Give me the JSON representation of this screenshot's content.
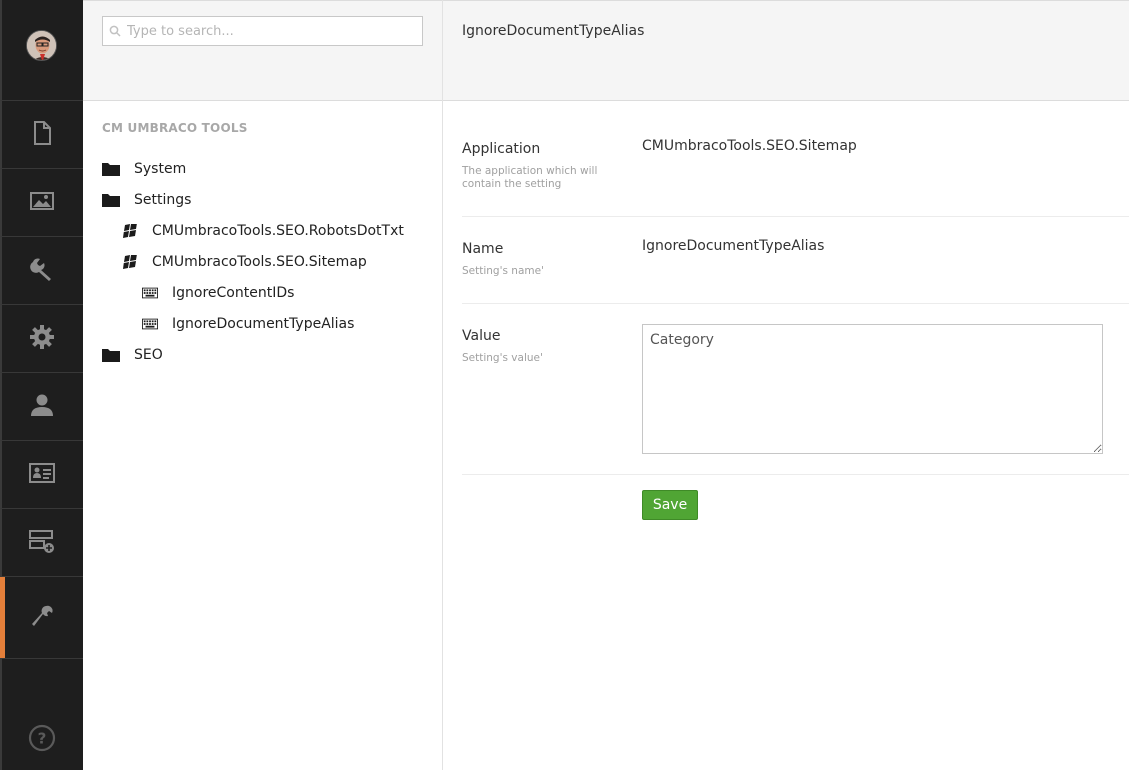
{
  "colors": {
    "accent": "#e47f3a",
    "sidebar": "#1e1e1e",
    "save": "#50a534"
  },
  "nav": {
    "items": [
      {
        "name": "content-icon"
      },
      {
        "name": "media-icon"
      },
      {
        "name": "developer-wrench-icon"
      },
      {
        "name": "settings-gear-icon"
      },
      {
        "name": "users-icon"
      },
      {
        "name": "members-card-icon"
      },
      {
        "name": "forms-icon"
      },
      {
        "name": "cm-umbraco-tools-icon",
        "active": true
      }
    ],
    "help_icon": "help-icon"
  },
  "search": {
    "placeholder": "Type to search..."
  },
  "tree": {
    "title": "CM UMBRACO TOOLS",
    "nodes": [
      {
        "label": "System",
        "icon": "folder-icon"
      },
      {
        "label": "Settings",
        "icon": "folder-icon"
      },
      {
        "label": "CMUmbracoTools.SEO.RobotsDotTxt",
        "icon": "windows-icon"
      },
      {
        "label": "CMUmbracoTools.SEO.Sitemap",
        "icon": "windows-icon"
      },
      {
        "label": "IgnoreContentIDs",
        "icon": "keyboard-icon"
      },
      {
        "label": "IgnoreDocumentTypeAlias",
        "icon": "keyboard-icon"
      },
      {
        "label": "SEO",
        "icon": "folder-icon"
      }
    ]
  },
  "editor": {
    "title": "IgnoreDocumentTypeAlias",
    "properties": {
      "application": {
        "label": "Application",
        "description": "The application which will contain the setting",
        "value": "CMUmbracoTools.SEO.Sitemap"
      },
      "name": {
        "label": "Name",
        "description": "Setting's name'",
        "value": "IgnoreDocumentTypeAlias"
      },
      "value": {
        "label": "Value",
        "description": "Setting's value'",
        "value": "Category"
      }
    },
    "save_label": "Save"
  }
}
